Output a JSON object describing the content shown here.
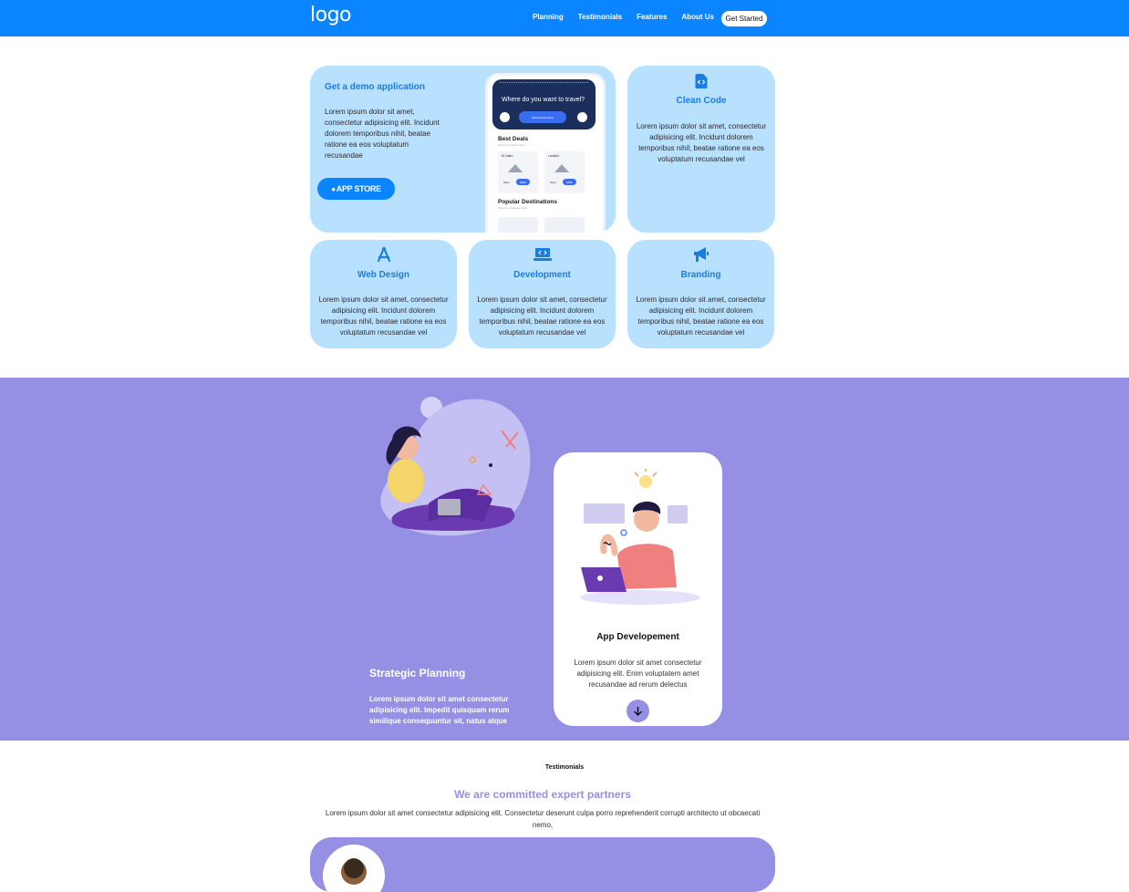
{
  "nav": {
    "logo": "logo",
    "links": [
      "Planning",
      "Testimonials",
      "Features",
      "About Us"
    ],
    "cta": "Get Started"
  },
  "demo": {
    "title": "Get a demo application",
    "text": "Lorem ipsum dolor sit amet, consectetur adipisicing elit. Incidunt dolorem temporibus nihil, beatae ratione ea eos voluptatum recusandae",
    "button": "APP STORE",
    "phone": {
      "question": "Where do you want to travel?",
      "chip": "Select Destination",
      "best_deals": "Best Deals",
      "best_deals_sub": "Sorted by lowest price",
      "deals": [
        {
          "name": "El Cairo",
          "more": "More",
          "price": "$200"
        },
        {
          "name": "London",
          "more": "More",
          "price": "$250"
        }
      ],
      "popular": "Popular Destinations",
      "popular_sub": "Sorted by highest rating"
    }
  },
  "cards": [
    {
      "icon": "file-code-icon",
      "title": "Clean Code",
      "text": "Lorem ipsum dolor sit amet, consectetur adipisicing elit. Incidunt dolorem temporibus nihil, beatae ratione ea eos voluptatum recusandae vel"
    },
    {
      "icon": "design-compass-icon",
      "title": "Web Design",
      "text": "Lorem ipsum dolor sit amet, consectetur adipisicing elit. Incidunt dolorem temporibus nihil, beatae ratione ea eos voluptatum recusandae vel"
    },
    {
      "icon": "laptop-code-icon",
      "title": "Development",
      "text": "Lorem ipsum dolor sit amet, consectetur adipisicing elit. Incidunt dolorem temporibus nihil, beatae ratione ea eos voluptatum recusandae vel"
    },
    {
      "icon": "megaphone-icon",
      "title": "Branding",
      "text": "Lorem ipsum dolor sit amet, consectetur adipisicing elit. Incidunt dolorem temporibus nihil, beatae ratione ea eos voluptatum recusandae vel"
    }
  ],
  "planning": {
    "title": "Strategic Planning",
    "text": "Lorem ipsum dolor sit amet consectetur adipisicing elit. Impedit quisquam rerum similique consequuntur sit, natus atque"
  },
  "app_dev": {
    "title": "App Developement",
    "text": "Lorem ipsum dolor sit amet consectetur adipisicing elit. Enim voluptatem amet recusandae ad rerum delectus"
  },
  "testimonials": {
    "label": "Testimonials",
    "heading": "We are committed expert partners",
    "text": "Lorem ipsum dolor sit amet consectetur adipisicing elit. Consectetur deserunt culpa porro reprehenderit corrupti architecto ut obcaecati nemo,"
  },
  "colors": {
    "nav": "#0a84ff",
    "card": "#b8e0ff",
    "accent_blue": "#1a7ee0",
    "purple": "#9590e3"
  }
}
